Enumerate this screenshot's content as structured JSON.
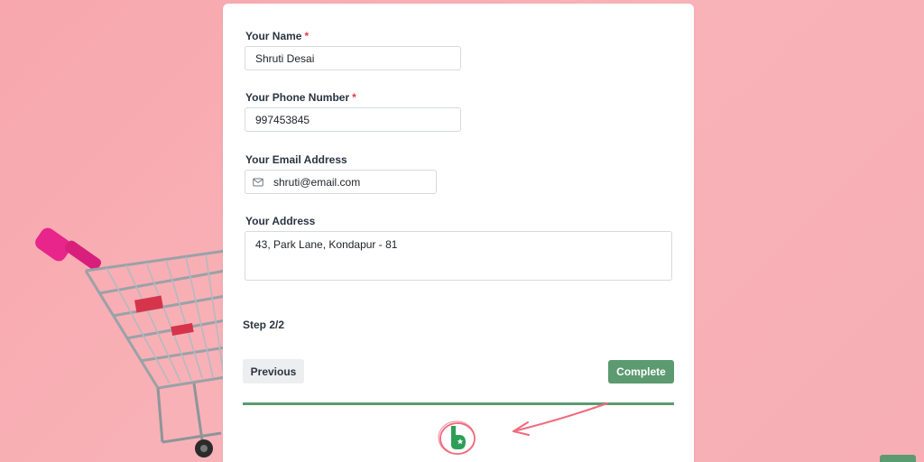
{
  "form": {
    "name": {
      "label": "Your Name",
      "required_mark": "*",
      "value": "Shruti Desai"
    },
    "phone": {
      "label": "Your Phone Number",
      "required_mark": "*",
      "value": "997453845"
    },
    "email": {
      "label": "Your Email Address",
      "icon": "mail-icon",
      "value": "shruti@email.com"
    },
    "address": {
      "label": "Your Address",
      "value": "43, Park Lane, Kondapur - 81"
    },
    "step_text": "Step 2/2",
    "progress_fraction": 1.0,
    "buttons": {
      "previous": "Previous",
      "complete": "Complete"
    }
  },
  "colors": {
    "background": "#f7a7ad",
    "accent_green": "#5c9a70",
    "required_red": "#e23b4a",
    "annotation_pink": "#f06a7e"
  }
}
